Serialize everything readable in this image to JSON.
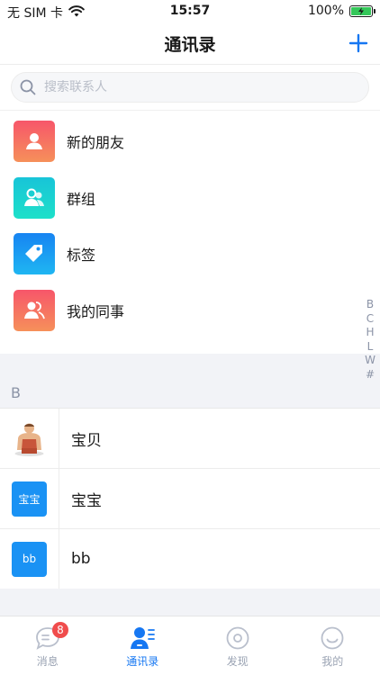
{
  "status_bar": {
    "carrier": "无 SIM 卡",
    "time": "15:57",
    "battery": "100%"
  },
  "nav": {
    "title": "通讯录"
  },
  "search": {
    "placeholder": "搜索联系人"
  },
  "functions": [
    {
      "label": "新的朋友",
      "icon": "person-icon",
      "color": "#f46a5a"
    },
    {
      "label": "群组",
      "icon": "group-icon",
      "color": "#19cdd4"
    },
    {
      "label": "标签",
      "icon": "tag-icon",
      "color": "#1a92f4"
    },
    {
      "label": "我的同事",
      "icon": "colleagues-icon",
      "color": "#f46a5a"
    }
  ],
  "index_letters": [
    "B",
    "C",
    "H",
    "L",
    "W",
    "#"
  ],
  "section": {
    "letter": "B"
  },
  "contacts": [
    {
      "name": "宝贝",
      "avatar_text": ""
    },
    {
      "name": "宝宝",
      "avatar_text": "宝宝"
    },
    {
      "name": "bb",
      "avatar_text": "bb"
    }
  ],
  "tabs": [
    {
      "label": "消息",
      "badge": "8"
    },
    {
      "label": "通讯录"
    },
    {
      "label": "发现"
    },
    {
      "label": "我的"
    }
  ],
  "colors": {
    "accent": "#1677f2",
    "badge": "#f04c4c",
    "avatar_blue": "#1a92f4"
  }
}
